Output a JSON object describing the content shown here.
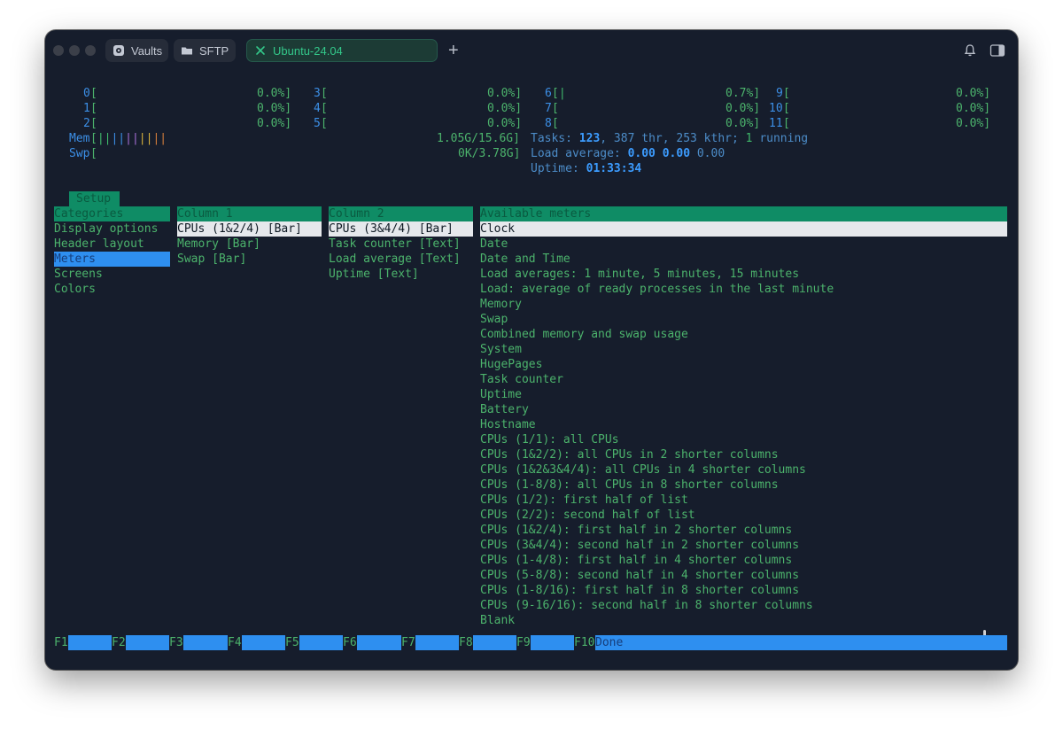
{
  "window": {
    "tabs": [
      {
        "label": "Vaults",
        "icon": "vault-icon"
      },
      {
        "label": "SFTP",
        "icon": "folder-icon"
      },
      {
        "label": "Ubuntu-24.04",
        "icon": "close-icon"
      }
    ],
    "new_tab_label": "+"
  },
  "meters": {
    "cpus": [
      {
        "id": "0",
        "pct": "0.0%]"
      },
      {
        "id": "1",
        "pct": "0.0%]"
      },
      {
        "id": "2",
        "pct": "0.0%]"
      },
      {
        "id": "3",
        "pct": "0.0%]"
      },
      {
        "id": "4",
        "pct": "0.0%]"
      },
      {
        "id": "5",
        "pct": "0.0%]"
      },
      {
        "id": "6",
        "pct": "0.7%]"
      },
      {
        "id": "7",
        "pct": "0.0%]"
      },
      {
        "id": "8",
        "pct": "0.0%]"
      },
      {
        "id": "9",
        "pct": "0.0%]"
      },
      {
        "id": "10",
        "pct": "0.0%]"
      },
      {
        "id": "11",
        "pct": "0.0%]"
      }
    ],
    "mem": {
      "label": "Mem",
      "value": "1.05G/15.6G]"
    },
    "swp": {
      "label": "Swp",
      "value": "0K/3.78G]"
    },
    "tasks": {
      "label": "Tasks:",
      "count": "123",
      "thr": ", 387 thr, 253 kthr;",
      "running_num": "1",
      "running": "running"
    },
    "load": {
      "label": "Load average:",
      "v1": "0.00",
      "v2": "0.00",
      "v3": "0.00"
    },
    "uptime": {
      "label": "Uptime:",
      "value": "01:33:34"
    }
  },
  "setup": {
    "tab_label": "Setup",
    "categories_header": "Categories",
    "categories": [
      "Display options",
      "Header layout",
      "Meters",
      "Screens",
      "Colors"
    ],
    "column1_header": "Column 1",
    "column1": [
      "CPUs (1&2/4) [Bar]",
      "Memory [Bar]",
      "Swap [Bar]"
    ],
    "column2_header": "Column 2",
    "column2": [
      "CPUs (3&4/4) [Bar]",
      "Task counter [Text]",
      "Load average [Text]",
      "Uptime [Text]"
    ],
    "available_header": "Available meters",
    "available": [
      "Clock",
      "Date",
      "Date and Time",
      "Load averages: 1 minute, 5 minutes, 15 minutes",
      "Load: average of ready processes in the last minute",
      "Memory",
      "Swap",
      "Combined memory and swap usage",
      "System",
      "HugePages",
      "Task counter",
      "Uptime",
      "Battery",
      "Hostname",
      "CPUs (1/1): all CPUs",
      "CPUs (1&2/2): all CPUs in 2 shorter columns",
      "CPUs (1&2&3&4/4): all CPUs in 4 shorter columns",
      "CPUs (1-8/8): all CPUs in 8 shorter columns",
      "CPUs (1/2): first half of list",
      "CPUs (2/2): second half of list",
      "CPUs (1&2/4): first half in 2 shorter columns",
      "CPUs (3&4/4): second half in 2 shorter columns",
      "CPUs (1-4/8): first half in 4 shorter columns",
      "CPUs (5-8/8): second half in 4 shorter columns",
      "CPUs (1-8/16): first half in 8 shorter columns",
      "CPUs (9-16/16): second half in 8 shorter columns",
      "Blank"
    ]
  },
  "fkeys": [
    {
      "key": "F1",
      "label": ""
    },
    {
      "key": "F2",
      "label": ""
    },
    {
      "key": "F3",
      "label": ""
    },
    {
      "key": "F4",
      "label": ""
    },
    {
      "key": "F5",
      "label": ""
    },
    {
      "key": "F6",
      "label": ""
    },
    {
      "key": "F7",
      "label": ""
    },
    {
      "key": "F8",
      "label": ""
    },
    {
      "key": "F9",
      "label": ""
    },
    {
      "key": "F10",
      "label": "Done"
    }
  ],
  "colors": {
    "terminal_bg": "#161d2c",
    "green_text": "#4cb36c",
    "blue_text": "#3c8fe6",
    "header_green": "#0f8c65",
    "selection_blue": "#2e8ff0"
  }
}
